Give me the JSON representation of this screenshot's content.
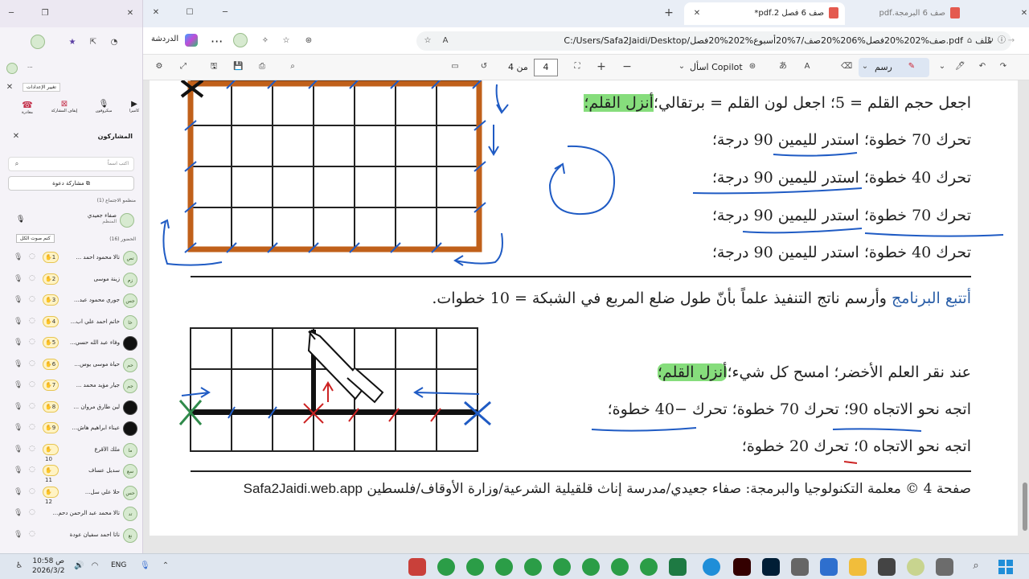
{
  "teams_panel": {
    "settings_label": "تغيير الإعدادات",
    "controls": [
      {
        "icon": "camera-icon",
        "label": "كاميرا"
      },
      {
        "icon": "microphone-icon",
        "label": "ميكروفون"
      },
      {
        "icon": "stop-share-icon",
        "label": "إيقاف المشاركة"
      },
      {
        "icon": "leave-icon",
        "label": "مغادرة"
      }
    ],
    "participants_title": "المشاركون",
    "search_placeholder": "اكتب اسماً",
    "share_invite_label": "مشاركة دعوة",
    "organizers_header": "منظمو الاجتماع (1)",
    "organizer": {
      "initials": "",
      "name": "صفاء جعيدي",
      "role": "المنظم"
    },
    "mute_all_label": "كتم صوت الكل",
    "attendees_header": "الحضور (16)",
    "attendees": [
      {
        "initials": "تص",
        "name": "تالا محمود احمد ...",
        "badge": "1"
      },
      {
        "initials": "زم",
        "name": "زينة موسى",
        "badge": "2"
      },
      {
        "initials": "جس",
        "name": "جوري محمود عبد...",
        "badge": "3"
      },
      {
        "initials": "خا",
        "name": "خاتم احمد علي اب...",
        "badge": "4"
      },
      {
        "initials": "",
        "name": "وفاء عبد الله حسي...",
        "badge": "5"
      },
      {
        "initials": "حم",
        "name": "حياة موسى يوس...",
        "badge": "6"
      },
      {
        "initials": "جم",
        "name": "جيار مؤيد محمد ...",
        "badge": "7"
      },
      {
        "initials": "",
        "name": "لين طارق مروان ...",
        "badge": "8"
      },
      {
        "initials": "",
        "name": "عيناء ابراهيم هاش...",
        "badge": "9"
      },
      {
        "initials": "ما",
        "name": "ملك الأقرع",
        "badge": "10"
      },
      {
        "initials": "سع",
        "name": "سديل عساف",
        "badge": "11"
      },
      {
        "initials": "حس",
        "name": "حلا علي سل...",
        "badge": "12"
      },
      {
        "initials": "تد",
        "name": "تالا محمد عبد الرحمن دحم...",
        "badge": ""
      },
      {
        "initials": "نع",
        "name": "ناتا احمد سفيان عودة",
        "badge": ""
      }
    ]
  },
  "browser": {
    "tabs": [
      {
        "title": "صف 6 فصل 2.pdf*",
        "active": true
      },
      {
        "title": "صف 6 البرمجة.pdf",
        "active": false
      }
    ],
    "chat_label": "الدردشة",
    "file_label": "ملف",
    "url": "C:/Users/Safa2Jaidi/Desktop/صف%202%20فصل%206%20صف/7%20أسبوع%202%20فصل.pdf"
  },
  "pdf_toolbar": {
    "draw_label": "رسم",
    "copilot_label": "اسأل Copilot",
    "page_current": "4",
    "page_total_label": "من 4"
  },
  "document": {
    "program1": [
      {
        "text": "اجعل حجم القلم = 5؛ اجعل لون القلم = برتقالي؛",
        "highlight": "أنزل القلم؛"
      },
      {
        "text": "تحرك 70 خطوة؛ استدر لليمين 90 درجة؛"
      },
      {
        "text": "تحرك 40 خطوة؛ استدر لليمين 90 درجة؛"
      },
      {
        "text": "تحرك 70 خطوة؛ استدر لليمين 90 درجة؛"
      },
      {
        "text": "تحرك 40 خطوة؛ استدر لليمين 90 درجة؛"
      }
    ],
    "instruction_blue": "أتتبع البرنامج",
    "instruction_rest": " وأرسم ناتج التنفيذ علماً بأنّ طول ضلع المربع في الشبكة = 10 خطوات.",
    "program2": [
      {
        "text": "عند نقر العلم الأخضر؛ امسح كل شيء؛",
        "highlight": "أنزل القلم؛"
      },
      {
        "text": "اتجه نحو الاتجاه 90؛ تحرك 70 خطوة؛ تحرك −40 خطوة؛"
      },
      {
        "text": "اتجه نحو الاتجاه 0؛ تحرك 20 خطوة؛"
      }
    ],
    "footer": "صفحة 4 © معلمة التكنولوجيا والبرمجة: صفاء جعيدي/مدرسة إناث قلقيلية الشرعية/وزارة الأوقاف/فلسطين",
    "footer_site": "Safa2Jaidi.web.app"
  },
  "taskbar": {
    "time": "10:58 ص",
    "date": "2026/3/2",
    "lang": "ENG"
  },
  "colors": {
    "accent": "#2b5fa8",
    "orange": "#c0601a",
    "green_highlight": "#86dd7c",
    "blue_highlight": "#b9d8f3"
  }
}
